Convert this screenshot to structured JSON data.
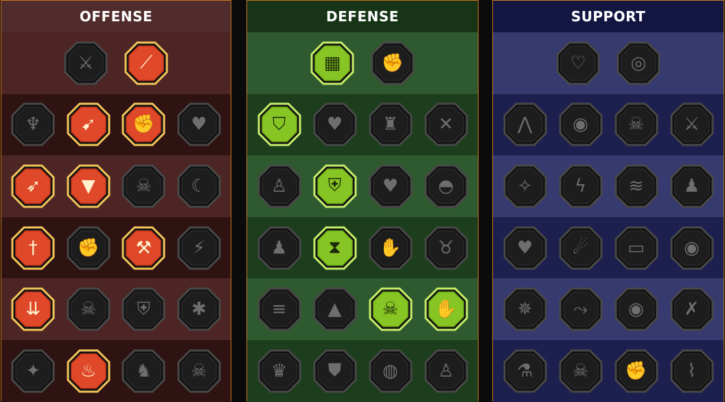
{
  "colors": {
    "offense_active_fill": "#e0482a",
    "offense_active_border": "#f3c65a",
    "defense_active_fill": "#86c523",
    "defense_active_border": "#c6ee6a",
    "inactive_fill": "#1d1d1d",
    "inactive_border": "#484848",
    "panel_border": "#c9761f"
  },
  "panels": [
    {
      "key": "offense",
      "title": "OFFENSE",
      "rows": [
        [
          {
            "icon": "crossed-swords-icon",
            "active": false
          },
          {
            "icon": "claw-slash-icon",
            "active": true
          }
        ],
        [
          {
            "icon": "demon-figure-icon",
            "active": false
          },
          {
            "icon": "spear-burst-icon",
            "active": true
          },
          {
            "icon": "smash-arm-icon",
            "active": true
          },
          {
            "icon": "bleeding-heart-icon",
            "active": false
          }
        ],
        [
          {
            "icon": "arrows-hit-icon",
            "active": true
          },
          {
            "icon": "fanged-mouth-icon",
            "active": true
          },
          {
            "icon": "skull-wind-icon",
            "active": false
          },
          {
            "icon": "scythe-hand-icon",
            "active": false
          }
        ],
        [
          {
            "icon": "dagger-drop-icon",
            "active": true
          },
          {
            "icon": "hammer-fist-icon",
            "active": false
          },
          {
            "icon": "axe-chop-icon",
            "active": true
          },
          {
            "icon": "chain-bolt-icon",
            "active": false
          }
        ],
        [
          {
            "icon": "arrow-rain-icon",
            "active": true
          },
          {
            "icon": "skull-pile-icon",
            "active": false
          },
          {
            "icon": "sword-shield-icon",
            "active": false
          },
          {
            "icon": "stunned-figure-icon",
            "active": false
          }
        ],
        [
          {
            "icon": "sparkle-blade-icon",
            "active": false
          },
          {
            "icon": "flaming-helm-icon",
            "active": true
          },
          {
            "icon": "beast-icon",
            "active": false
          },
          {
            "icon": "skull-burst-icon",
            "active": false
          }
        ]
      ]
    },
    {
      "key": "defense",
      "title": "DEFENSE",
      "rows": [
        [
          {
            "icon": "armor-plates-icon",
            "active": true
          },
          {
            "icon": "raised-fist-icon",
            "active": false
          }
        ],
        [
          {
            "icon": "chevron-shield-icon",
            "active": true
          },
          {
            "icon": "heart-hand-icon",
            "active": false
          },
          {
            "icon": "stone-golem-icon",
            "active": false
          },
          {
            "icon": "crossed-blades-icon",
            "active": false
          }
        ],
        [
          {
            "icon": "dodge-figure-icon",
            "active": false
          },
          {
            "icon": "knight-shield-icon",
            "active": true
          },
          {
            "icon": "skull-heart-icon",
            "active": false
          },
          {
            "icon": "hooded-head-icon",
            "active": false
          }
        ],
        [
          {
            "icon": "crowd-icon",
            "active": false
          },
          {
            "icon": "hourglass-icon",
            "active": true
          },
          {
            "icon": "open-palm-icon",
            "active": false
          },
          {
            "icon": "bull-head-icon",
            "active": false
          }
        ],
        [
          {
            "icon": "dash-figure-icon",
            "active": false
          },
          {
            "icon": "spikes-icon",
            "active": false
          },
          {
            "icon": "radiant-skull-icon",
            "active": true
          },
          {
            "icon": "grab-hand-icon",
            "active": true
          }
        ],
        [
          {
            "icon": "spiked-head-icon",
            "active": false
          },
          {
            "icon": "winged-shield-icon",
            "active": false
          },
          {
            "icon": "grim-face-icon",
            "active": false
          },
          {
            "icon": "flex-figure-icon",
            "active": false
          }
        ]
      ]
    },
    {
      "key": "support",
      "title": "SUPPORT",
      "rows": [
        [
          {
            "icon": "heart-plus-icon",
            "active": false
          },
          {
            "icon": "vortex-icon",
            "active": false
          }
        ],
        [
          {
            "icon": "praying-hands-icon",
            "active": false
          },
          {
            "icon": "shield-rings-icon",
            "active": false
          },
          {
            "icon": "skull-smoke-icon",
            "active": false
          },
          {
            "icon": "broken-sword-icon",
            "active": false
          }
        ],
        [
          {
            "icon": "sparkle-figure-icon",
            "active": false
          },
          {
            "icon": "lightning-icon",
            "active": false
          },
          {
            "icon": "wind-bolt-icon",
            "active": false
          },
          {
            "icon": "twin-figures-icon",
            "active": false
          }
        ],
        [
          {
            "icon": "chained-heart-icon",
            "active": false
          },
          {
            "icon": "comet-icon",
            "active": false
          },
          {
            "icon": "open-book-icon",
            "active": false
          },
          {
            "icon": "glaring-eyes-icon",
            "active": false
          }
        ],
        [
          {
            "icon": "compass-star-icon",
            "active": false
          },
          {
            "icon": "speed-boot-icon",
            "active": false
          },
          {
            "icon": "all-seeing-eye-icon",
            "active": false
          },
          {
            "icon": "crossed-figure-icon",
            "active": false
          }
        ],
        [
          {
            "icon": "poison-flask-icon",
            "active": false
          },
          {
            "icon": "skull-wings-icon",
            "active": false
          },
          {
            "icon": "fist-rays-icon",
            "active": false
          },
          {
            "icon": "eagle-head-icon",
            "active": false
          }
        ]
      ]
    }
  ],
  "glyphs": {
    "crossed-swords-icon": "⚔",
    "claw-slash-icon": "⟋",
    "demon-figure-icon": "♆",
    "spear-burst-icon": "➹",
    "smash-arm-icon": "✊",
    "bleeding-heart-icon": "♥",
    "arrows-hit-icon": "➶",
    "fanged-mouth-icon": "▼",
    "skull-wind-icon": "☠",
    "scythe-hand-icon": "☾",
    "dagger-drop-icon": "†",
    "hammer-fist-icon": "✊",
    "axe-chop-icon": "⚒",
    "chain-bolt-icon": "⚡",
    "arrow-rain-icon": "⇊",
    "skull-pile-icon": "☠",
    "sword-shield-icon": "⛨",
    "stunned-figure-icon": "✱",
    "sparkle-blade-icon": "✦",
    "flaming-helm-icon": "♨",
    "beast-icon": "♞",
    "skull-burst-icon": "☠",
    "armor-plates-icon": "▦",
    "raised-fist-icon": "✊",
    "chevron-shield-icon": "⛉",
    "heart-hand-icon": "♥",
    "stone-golem-icon": "♜",
    "crossed-blades-icon": "✕",
    "dodge-figure-icon": "♙",
    "knight-shield-icon": "⛨",
    "skull-heart-icon": "♥",
    "hooded-head-icon": "◓",
    "crowd-icon": "♟",
    "hourglass-icon": "⧗",
    "open-palm-icon": "✋",
    "bull-head-icon": "♉",
    "dash-figure-icon": "≡",
    "spikes-icon": "▲",
    "radiant-skull-icon": "☠",
    "grab-hand-icon": "✋",
    "spiked-head-icon": "♛",
    "winged-shield-icon": "⛊",
    "grim-face-icon": "◍",
    "flex-figure-icon": "♙",
    "heart-plus-icon": "♡",
    "vortex-icon": "◎",
    "praying-hands-icon": "⋀",
    "shield-rings-icon": "◉",
    "skull-smoke-icon": "☠",
    "broken-sword-icon": "⚔",
    "sparkle-figure-icon": "✧",
    "lightning-icon": "ϟ",
    "wind-bolt-icon": "≋",
    "twin-figures-icon": "♟",
    "chained-heart-icon": "♥",
    "comet-icon": "☄",
    "open-book-icon": "▭",
    "glaring-eyes-icon": "◉",
    "compass-star-icon": "✵",
    "speed-boot-icon": "⤳",
    "all-seeing-eye-icon": "◉",
    "crossed-figure-icon": "✗",
    "poison-flask-icon": "⚗",
    "skull-wings-icon": "☠",
    "fist-rays-icon": "✊",
    "eagle-head-icon": "⌇"
  }
}
